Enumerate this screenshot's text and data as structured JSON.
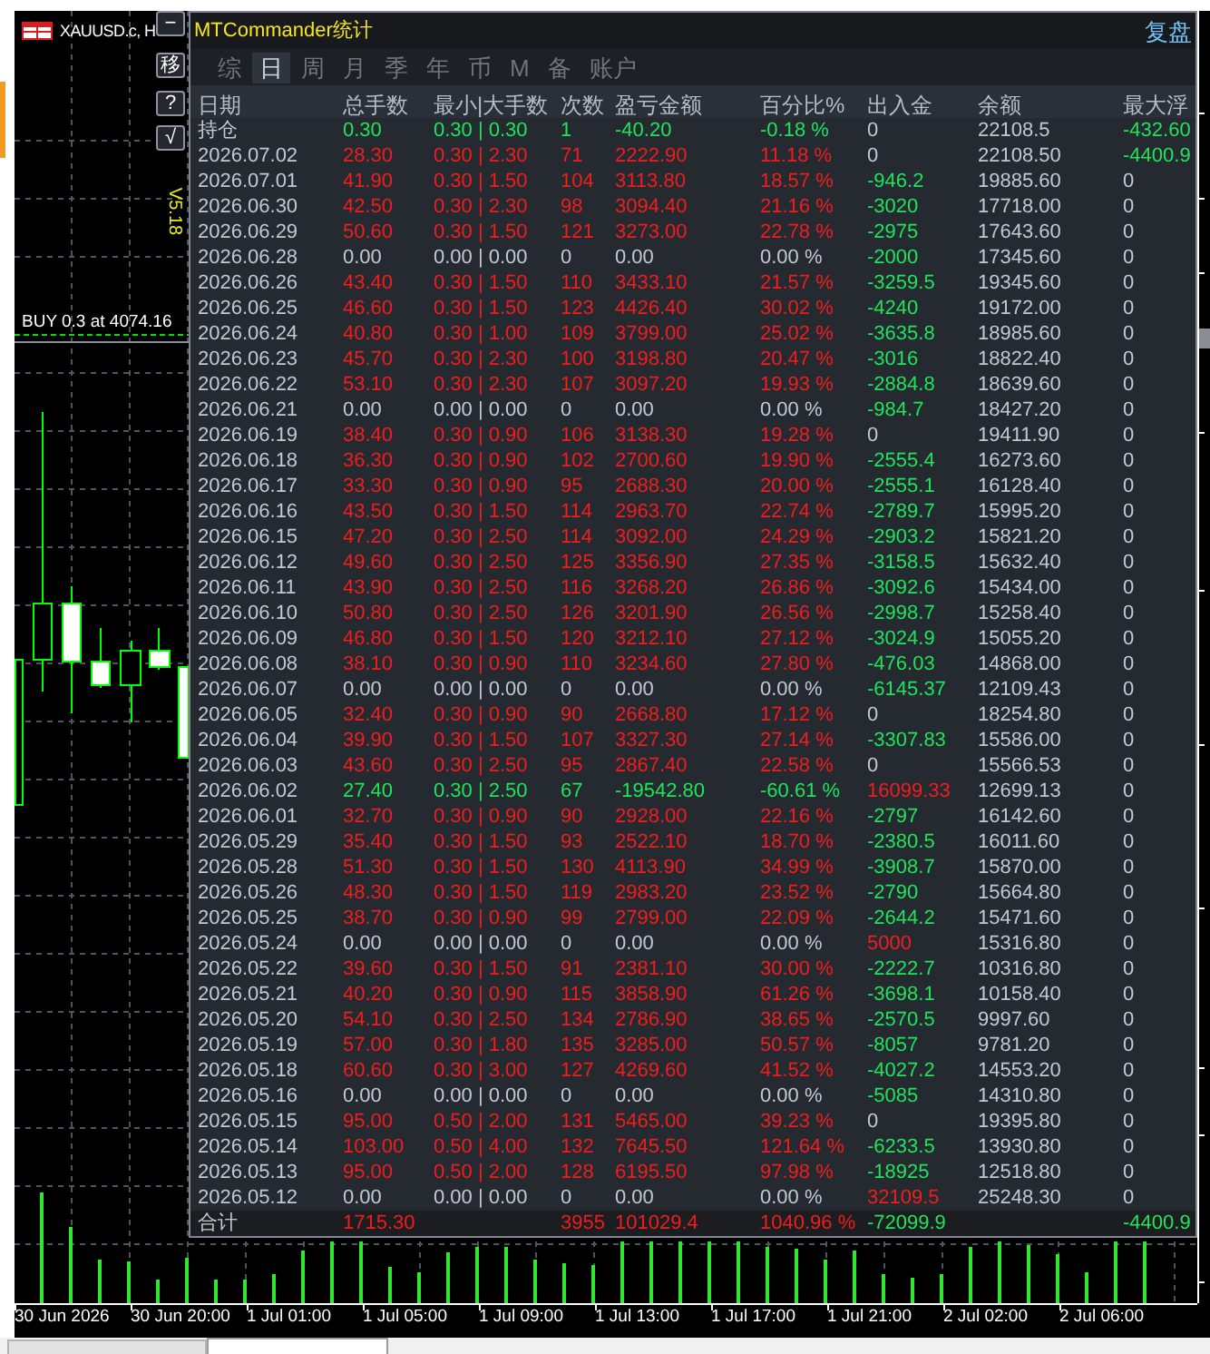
{
  "chart": {
    "symbol": "XAUUSD.c, H",
    "version": "V5.18",
    "order_label": "BUY 0.3 at 4074.16",
    "time_axis": [
      "30 Jun 2026",
      "30 Jun 20:00",
      "1 Jul 01:00",
      "1 Jul 05:00",
      "1 Jul 09:00",
      "1 Jul 13:00",
      "1 Jul 17:00",
      "1 Jul 21:00",
      "2 Jul 02:00",
      "2 Jul 06:00"
    ]
  },
  "panel": {
    "buttons": [
      "−",
      "移",
      "?",
      "√"
    ],
    "title": "MTCommander统计",
    "replay_link": "复盘",
    "tabs": [
      {
        "label": "综",
        "selected": false
      },
      {
        "label": "日",
        "selected": true
      },
      {
        "label": "周",
        "selected": false
      },
      {
        "label": "月",
        "selected": false
      },
      {
        "label": "季",
        "selected": false
      },
      {
        "label": "年",
        "selected": false
      },
      {
        "label": "币",
        "selected": false
      },
      {
        "label": "M",
        "selected": false
      },
      {
        "label": "备",
        "selected": false
      },
      {
        "label": "账户",
        "selected": false
      }
    ],
    "columns": [
      "日期",
      "总手数",
      "最小|大手数",
      "次数",
      "盈亏金额",
      "百分比%",
      "出入金",
      "余额",
      "最大浮"
    ],
    "rows": [
      {
        "date": "持仓",
        "lots": "0.30",
        "lot_range": "0.30 | 0.30",
        "trades": "1",
        "pnl": "-40.20",
        "percent": "-0.18 %",
        "color": "#1fe35b",
        "cash_flow": {
          "text": "0",
          "color": "#c3c8d0"
        },
        "balance": "22108.5",
        "max_float": {
          "text": "-432.60",
          "color": "#1fe35b"
        }
      },
      {
        "date": "2026.07.02",
        "lots": "28.30",
        "lot_range": "0.30 | 2.30",
        "trades": "71",
        "pnl": "2222.90",
        "percent": "11.18 %",
        "color": "#f01d1d",
        "cash_flow": {
          "text": "0",
          "color": "#c3c8d0"
        },
        "balance": "22108.50",
        "max_float": {
          "text": "-4400.9",
          "color": "#1fe35b"
        }
      },
      {
        "date": "2026.07.01",
        "lots": "41.90",
        "lot_range": "0.30 | 1.50",
        "trades": "104",
        "pnl": "3113.80",
        "percent": "18.57 %",
        "color": "#f01d1d",
        "cash_flow": {
          "text": "-946.2",
          "color": "#1fe35b"
        },
        "balance": "19885.60",
        "max_float": {
          "text": "0",
          "color": "#c3c8d0"
        }
      },
      {
        "date": "2026.06.30",
        "lots": "42.50",
        "lot_range": "0.30 | 2.30",
        "trades": "98",
        "pnl": "3094.40",
        "percent": "21.16 %",
        "color": "#f01d1d",
        "cash_flow": {
          "text": "-3020",
          "color": "#1fe35b"
        },
        "balance": "17718.00",
        "max_float": {
          "text": "0",
          "color": "#c3c8d0"
        }
      },
      {
        "date": "2026.06.29",
        "lots": "50.60",
        "lot_range": "0.30 | 1.50",
        "trades": "121",
        "pnl": "3273.00",
        "percent": "22.78 %",
        "color": "#f01d1d",
        "cash_flow": {
          "text": "-2975",
          "color": "#1fe35b"
        },
        "balance": "17643.60",
        "max_float": {
          "text": "0",
          "color": "#c3c8d0"
        }
      },
      {
        "date": "2026.06.28",
        "lots": "0.00",
        "lot_range": "0.00 | 0.00",
        "trades": "0",
        "pnl": "0.00",
        "percent": "0.00 %",
        "color": "#c3c8d0",
        "cash_flow": {
          "text": "-2000",
          "color": "#1fe35b"
        },
        "balance": "17345.60",
        "max_float": {
          "text": "0",
          "color": "#c3c8d0"
        }
      },
      {
        "date": "2026.06.26",
        "lots": "43.40",
        "lot_range": "0.30 | 1.50",
        "trades": "110",
        "pnl": "3433.10",
        "percent": "21.57 %",
        "color": "#f01d1d",
        "cash_flow": {
          "text": "-3259.5",
          "color": "#1fe35b"
        },
        "balance": "19345.60",
        "max_float": {
          "text": "0",
          "color": "#c3c8d0"
        }
      },
      {
        "date": "2026.06.25",
        "lots": "46.60",
        "lot_range": "0.30 | 1.50",
        "trades": "123",
        "pnl": "4426.40",
        "percent": "30.02 %",
        "color": "#f01d1d",
        "cash_flow": {
          "text": "-4240",
          "color": "#1fe35b"
        },
        "balance": "19172.00",
        "max_float": {
          "text": "0",
          "color": "#c3c8d0"
        }
      },
      {
        "date": "2026.06.24",
        "lots": "40.80",
        "lot_range": "0.30 | 1.00",
        "trades": "109",
        "pnl": "3799.00",
        "percent": "25.02 %",
        "color": "#f01d1d",
        "cash_flow": {
          "text": "-3635.8",
          "color": "#1fe35b"
        },
        "balance": "18985.60",
        "max_float": {
          "text": "0",
          "color": "#c3c8d0"
        }
      },
      {
        "date": "2026.06.23",
        "lots": "45.70",
        "lot_range": "0.30 | 2.30",
        "trades": "100",
        "pnl": "3198.80",
        "percent": "20.47 %",
        "color": "#f01d1d",
        "cash_flow": {
          "text": "-3016",
          "color": "#1fe35b"
        },
        "balance": "18822.40",
        "max_float": {
          "text": "0",
          "color": "#c3c8d0"
        }
      },
      {
        "date": "2026.06.22",
        "lots": "53.10",
        "lot_range": "0.30 | 2.30",
        "trades": "107",
        "pnl": "3097.20",
        "percent": "19.93 %",
        "color": "#f01d1d",
        "cash_flow": {
          "text": "-2884.8",
          "color": "#1fe35b"
        },
        "balance": "18639.60",
        "max_float": {
          "text": "0",
          "color": "#c3c8d0"
        }
      },
      {
        "date": "2026.06.21",
        "lots": "0.00",
        "lot_range": "0.00 | 0.00",
        "trades": "0",
        "pnl": "0.00",
        "percent": "0.00 %",
        "color": "#c3c8d0",
        "cash_flow": {
          "text": "-984.7",
          "color": "#1fe35b"
        },
        "balance": "18427.20",
        "max_float": {
          "text": "0",
          "color": "#c3c8d0"
        }
      },
      {
        "date": "2026.06.19",
        "lots": "38.40",
        "lot_range": "0.30 | 0.90",
        "trades": "106",
        "pnl": "3138.30",
        "percent": "19.28 %",
        "color": "#f01d1d",
        "cash_flow": {
          "text": "0",
          "color": "#c3c8d0"
        },
        "balance": "19411.90",
        "max_float": {
          "text": "0",
          "color": "#c3c8d0"
        }
      },
      {
        "date": "2026.06.18",
        "lots": "36.30",
        "lot_range": "0.30 | 0.90",
        "trades": "102",
        "pnl": "2700.60",
        "percent": "19.90 %",
        "color": "#f01d1d",
        "cash_flow": {
          "text": "-2555.4",
          "color": "#1fe35b"
        },
        "balance": "16273.60",
        "max_float": {
          "text": "0",
          "color": "#c3c8d0"
        }
      },
      {
        "date": "2026.06.17",
        "lots": "33.30",
        "lot_range": "0.30 | 0.90",
        "trades": "95",
        "pnl": "2688.30",
        "percent": "20.00 %",
        "color": "#f01d1d",
        "cash_flow": {
          "text": "-2555.1",
          "color": "#1fe35b"
        },
        "balance": "16128.40",
        "max_float": {
          "text": "0",
          "color": "#c3c8d0"
        }
      },
      {
        "date": "2026.06.16",
        "lots": "43.50",
        "lot_range": "0.30 | 1.50",
        "trades": "114",
        "pnl": "2963.70",
        "percent": "22.74 %",
        "color": "#f01d1d",
        "cash_flow": {
          "text": "-2789.7",
          "color": "#1fe35b"
        },
        "balance": "15995.20",
        "max_float": {
          "text": "0",
          "color": "#c3c8d0"
        }
      },
      {
        "date": "2026.06.15",
        "lots": "47.20",
        "lot_range": "0.30 | 2.50",
        "trades": "114",
        "pnl": "3092.00",
        "percent": "24.29 %",
        "color": "#f01d1d",
        "cash_flow": {
          "text": "-2903.2",
          "color": "#1fe35b"
        },
        "balance": "15821.20",
        "max_float": {
          "text": "0",
          "color": "#c3c8d0"
        }
      },
      {
        "date": "2026.06.12",
        "lots": "49.60",
        "lot_range": "0.30 | 2.50",
        "trades": "125",
        "pnl": "3356.90",
        "percent": "27.35 %",
        "color": "#f01d1d",
        "cash_flow": {
          "text": "-3158.5",
          "color": "#1fe35b"
        },
        "balance": "15632.40",
        "max_float": {
          "text": "0",
          "color": "#c3c8d0"
        }
      },
      {
        "date": "2026.06.11",
        "lots": "43.90",
        "lot_range": "0.30 | 2.50",
        "trades": "116",
        "pnl": "3268.20",
        "percent": "26.86 %",
        "color": "#f01d1d",
        "cash_flow": {
          "text": "-3092.6",
          "color": "#1fe35b"
        },
        "balance": "15434.00",
        "max_float": {
          "text": "0",
          "color": "#c3c8d0"
        }
      },
      {
        "date": "2026.06.10",
        "lots": "50.80",
        "lot_range": "0.30 | 2.50",
        "trades": "126",
        "pnl": "3201.90",
        "percent": "26.56 %",
        "color": "#f01d1d",
        "cash_flow": {
          "text": "-2998.7",
          "color": "#1fe35b"
        },
        "balance": "15258.40",
        "max_float": {
          "text": "0",
          "color": "#c3c8d0"
        }
      },
      {
        "date": "2026.06.09",
        "lots": "46.80",
        "lot_range": "0.30 | 1.50",
        "trades": "120",
        "pnl": "3212.10",
        "percent": "27.12 %",
        "color": "#f01d1d",
        "cash_flow": {
          "text": "-3024.9",
          "color": "#1fe35b"
        },
        "balance": "15055.20",
        "max_float": {
          "text": "0",
          "color": "#c3c8d0"
        }
      },
      {
        "date": "2026.06.08",
        "lots": "38.10",
        "lot_range": "0.30 | 0.90",
        "trades": "110",
        "pnl": "3234.60",
        "percent": "27.80 %",
        "color": "#f01d1d",
        "cash_flow": {
          "text": "-476.03",
          "color": "#1fe35b"
        },
        "balance": "14868.00",
        "max_float": {
          "text": "0",
          "color": "#c3c8d0"
        }
      },
      {
        "date": "2026.06.07",
        "lots": "0.00",
        "lot_range": "0.00 | 0.00",
        "trades": "0",
        "pnl": "0.00",
        "percent": "0.00 %",
        "color": "#c3c8d0",
        "cash_flow": {
          "text": "-6145.37",
          "color": "#1fe35b"
        },
        "balance": "12109.43",
        "max_float": {
          "text": "0",
          "color": "#c3c8d0"
        }
      },
      {
        "date": "2026.06.05",
        "lots": "32.40",
        "lot_range": "0.30 | 0.90",
        "trades": "90",
        "pnl": "2668.80",
        "percent": "17.12 %",
        "color": "#f01d1d",
        "cash_flow": {
          "text": "0",
          "color": "#c3c8d0"
        },
        "balance": "18254.80",
        "max_float": {
          "text": "0",
          "color": "#c3c8d0"
        }
      },
      {
        "date": "2026.06.04",
        "lots": "39.90",
        "lot_range": "0.30 | 1.50",
        "trades": "107",
        "pnl": "3327.30",
        "percent": "27.14 %",
        "color": "#f01d1d",
        "cash_flow": {
          "text": "-3307.83",
          "color": "#1fe35b"
        },
        "balance": "15586.00",
        "max_float": {
          "text": "0",
          "color": "#c3c8d0"
        }
      },
      {
        "date": "2026.06.03",
        "lots": "43.60",
        "lot_range": "0.30 | 2.50",
        "trades": "95",
        "pnl": "2867.40",
        "percent": "22.58 %",
        "color": "#f01d1d",
        "cash_flow": {
          "text": "0",
          "color": "#c3c8d0"
        },
        "balance": "15566.53",
        "max_float": {
          "text": "0",
          "color": "#c3c8d0"
        }
      },
      {
        "date": "2026.06.02",
        "lots": "27.40",
        "lot_range": "0.30 | 2.50",
        "trades": "67",
        "pnl": "-19542.80",
        "percent": "-60.61 %",
        "color": "#1fe35b",
        "cash_flow": {
          "text": "16099.33",
          "color": "#f01d1d"
        },
        "balance": "12699.13",
        "max_float": {
          "text": "0",
          "color": "#c3c8d0"
        }
      },
      {
        "date": "2026.06.01",
        "lots": "32.70",
        "lot_range": "0.30 | 0.90",
        "trades": "90",
        "pnl": "2928.00",
        "percent": "22.16 %",
        "color": "#f01d1d",
        "cash_flow": {
          "text": "-2797",
          "color": "#1fe35b"
        },
        "balance": "16142.60",
        "max_float": {
          "text": "0",
          "color": "#c3c8d0"
        }
      },
      {
        "date": "2026.05.29",
        "lots": "35.40",
        "lot_range": "0.30 | 1.50",
        "trades": "93",
        "pnl": "2522.10",
        "percent": "18.70 %",
        "color": "#f01d1d",
        "cash_flow": {
          "text": "-2380.5",
          "color": "#1fe35b"
        },
        "balance": "16011.60",
        "max_float": {
          "text": "0",
          "color": "#c3c8d0"
        }
      },
      {
        "date": "2026.05.28",
        "lots": "51.30",
        "lot_range": "0.30 | 1.50",
        "trades": "130",
        "pnl": "4113.90",
        "percent": "34.99 %",
        "color": "#f01d1d",
        "cash_flow": {
          "text": "-3908.7",
          "color": "#1fe35b"
        },
        "balance": "15870.00",
        "max_float": {
          "text": "0",
          "color": "#c3c8d0"
        }
      },
      {
        "date": "2026.05.26",
        "lots": "48.30",
        "lot_range": "0.30 | 1.50",
        "trades": "119",
        "pnl": "2983.20",
        "percent": "23.52 %",
        "color": "#f01d1d",
        "cash_flow": {
          "text": "-2790",
          "color": "#1fe35b"
        },
        "balance": "15664.80",
        "max_float": {
          "text": "0",
          "color": "#c3c8d0"
        }
      },
      {
        "date": "2026.05.25",
        "lots": "38.70",
        "lot_range": "0.30 | 0.90",
        "trades": "99",
        "pnl": "2799.00",
        "percent": "22.09 %",
        "color": "#f01d1d",
        "cash_flow": {
          "text": "-2644.2",
          "color": "#1fe35b"
        },
        "balance": "15471.60",
        "max_float": {
          "text": "0",
          "color": "#c3c8d0"
        }
      },
      {
        "date": "2026.05.24",
        "lots": "0.00",
        "lot_range": "0.00 | 0.00",
        "trades": "0",
        "pnl": "0.00",
        "percent": "0.00 %",
        "color": "#c3c8d0",
        "cash_flow": {
          "text": "5000",
          "color": "#f01d1d"
        },
        "balance": "15316.80",
        "max_float": {
          "text": "0",
          "color": "#c3c8d0"
        }
      },
      {
        "date": "2026.05.22",
        "lots": "39.60",
        "lot_range": "0.30 | 1.50",
        "trades": "91",
        "pnl": "2381.10",
        "percent": "30.00 %",
        "color": "#f01d1d",
        "cash_flow": {
          "text": "-2222.7",
          "color": "#1fe35b"
        },
        "balance": "10316.80",
        "max_float": {
          "text": "0",
          "color": "#c3c8d0"
        }
      },
      {
        "date": "2026.05.21",
        "lots": "40.20",
        "lot_range": "0.30 | 0.90",
        "trades": "115",
        "pnl": "3858.90",
        "percent": "61.26 %",
        "color": "#f01d1d",
        "cash_flow": {
          "text": "-3698.1",
          "color": "#1fe35b"
        },
        "balance": "10158.40",
        "max_float": {
          "text": "0",
          "color": "#c3c8d0"
        }
      },
      {
        "date": "2026.05.20",
        "lots": "54.10",
        "lot_range": "0.30 | 2.50",
        "trades": "134",
        "pnl": "2786.90",
        "percent": "38.65 %",
        "color": "#f01d1d",
        "cash_flow": {
          "text": "-2570.5",
          "color": "#1fe35b"
        },
        "balance": "9997.60",
        "max_float": {
          "text": "0",
          "color": "#c3c8d0"
        }
      },
      {
        "date": "2026.05.19",
        "lots": "57.00",
        "lot_range": "0.30 | 1.80",
        "trades": "135",
        "pnl": "3285.00",
        "percent": "50.57 %",
        "color": "#f01d1d",
        "cash_flow": {
          "text": "-8057",
          "color": "#1fe35b"
        },
        "balance": "9781.20",
        "max_float": {
          "text": "0",
          "color": "#c3c8d0"
        }
      },
      {
        "date": "2026.05.18",
        "lots": "60.60",
        "lot_range": "0.30 | 3.00",
        "trades": "127",
        "pnl": "4269.60",
        "percent": "41.52 %",
        "color": "#f01d1d",
        "cash_flow": {
          "text": "-4027.2",
          "color": "#1fe35b"
        },
        "balance": "14553.20",
        "max_float": {
          "text": "0",
          "color": "#c3c8d0"
        }
      },
      {
        "date": "2026.05.16",
        "lots": "0.00",
        "lot_range": "0.00 | 0.00",
        "trades": "0",
        "pnl": "0.00",
        "percent": "0.00 %",
        "color": "#c3c8d0",
        "cash_flow": {
          "text": "-5085",
          "color": "#1fe35b"
        },
        "balance": "14310.80",
        "max_float": {
          "text": "0",
          "color": "#c3c8d0"
        }
      },
      {
        "date": "2026.05.15",
        "lots": "95.00",
        "lot_range": "0.50 | 2.00",
        "trades": "131",
        "pnl": "5465.00",
        "percent": "39.23 %",
        "color": "#f01d1d",
        "cash_flow": {
          "text": "0",
          "color": "#c3c8d0"
        },
        "balance": "19395.80",
        "max_float": {
          "text": "0",
          "color": "#c3c8d0"
        }
      },
      {
        "date": "2026.05.14",
        "lots": "103.00",
        "lot_range": "0.50 | 4.00",
        "trades": "132",
        "pnl": "7645.50",
        "percent": "121.64 %",
        "color": "#f01d1d",
        "cash_flow": {
          "text": "-6233.5",
          "color": "#1fe35b"
        },
        "balance": "13930.80",
        "max_float": {
          "text": "0",
          "color": "#c3c8d0"
        }
      },
      {
        "date": "2026.05.13",
        "lots": "95.00",
        "lot_range": "0.50 | 2.00",
        "trades": "128",
        "pnl": "6195.50",
        "percent": "97.98 %",
        "color": "#f01d1d",
        "cash_flow": {
          "text": "-18925",
          "color": "#1fe35b"
        },
        "balance": "12518.80",
        "max_float": {
          "text": "0",
          "color": "#c3c8d0"
        }
      },
      {
        "date": "2026.05.12",
        "lots": "0.00",
        "lot_range": "0.00 | 0.00",
        "trades": "0",
        "pnl": "0.00",
        "percent": "0.00 %",
        "color": "#c3c8d0",
        "cash_flow": {
          "text": "32109.5",
          "color": "#f01d1d"
        },
        "balance": "25248.30",
        "max_float": {
          "text": "0",
          "color": "#c3c8d0"
        }
      }
    ],
    "total": {
      "label": "合计",
      "lots": "1715.30",
      "trades": "3955",
      "pnl": "101029.4",
      "percent": "1040.96 %",
      "color": "#f01d1d",
      "cash_flow": {
        "text": "-72099.9",
        "color": "#1fe35b"
      },
      "max_float": {
        "text": "-4400.9",
        "color": "#1fe35b"
      }
    }
  },
  "bottom_tabs": [
    {
      "selected": false
    },
    {
      "selected": true
    }
  ]
}
